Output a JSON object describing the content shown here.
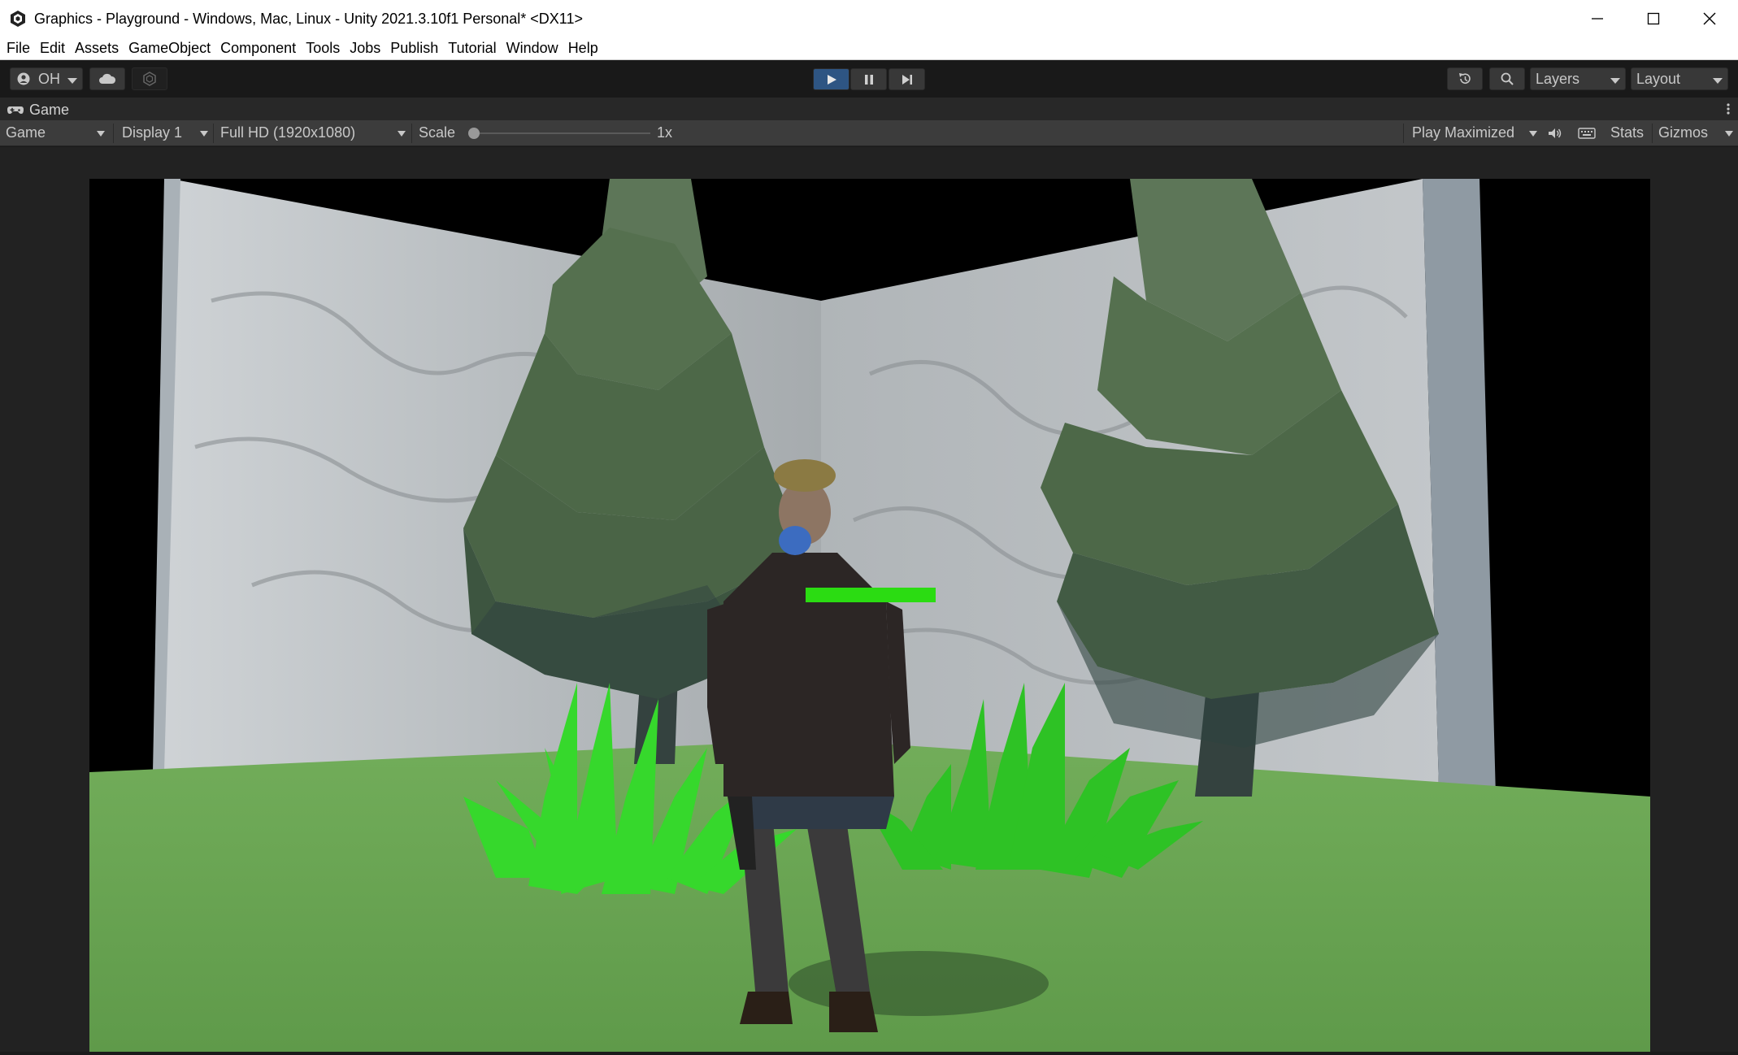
{
  "window": {
    "title": "Graphics - Playground - Windows, Mac, Linux - Unity 2021.3.10f1 Personal* <DX11>"
  },
  "menu": [
    "File",
    "Edit",
    "Assets",
    "GameObject",
    "Component",
    "Tools",
    "Jobs",
    "Publish",
    "Tutorial",
    "Window",
    "Help"
  ],
  "toolbar": {
    "account_label": "OH",
    "layers_label": "Layers",
    "layout_label": "Layout"
  },
  "panel": {
    "tab_label": "Game"
  },
  "game_toolbar": {
    "view_mode": "Game",
    "display": "Display 1",
    "resolution": "Full HD (1920x1080)",
    "scale_label": "Scale",
    "scale_value": "1x",
    "scale_slider_fraction": 0.0,
    "play_mode": "Play Maximized",
    "stats_label": "Stats",
    "gizmos_label": "Gizmos"
  },
  "game_view": {
    "health_bar_fraction": 1.0,
    "colors": {
      "health": "#2bdc12",
      "ground": "#6aa651",
      "wall": "#b8bcbf",
      "tree": "#4f6a4b",
      "grass": "#36d82c",
      "play_active": "#2e5583"
    }
  }
}
